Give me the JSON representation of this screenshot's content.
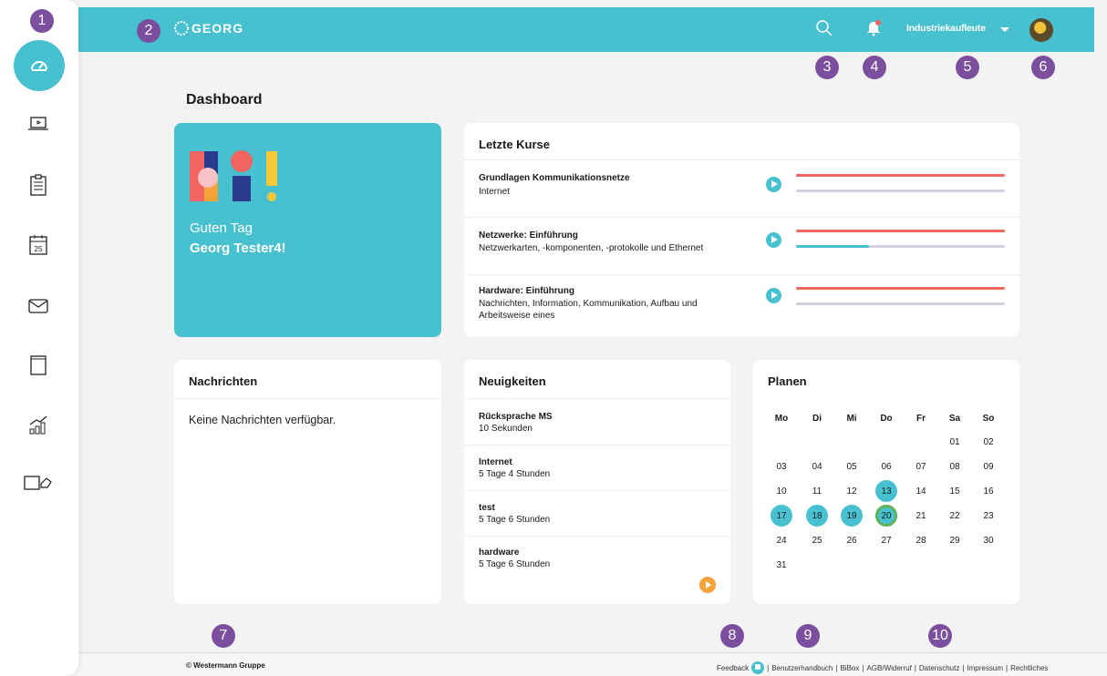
{
  "brand": {
    "name": "GEORG"
  },
  "header": {
    "role": "Industriekaufleute"
  },
  "page": {
    "title": "Dashboard"
  },
  "badges": [
    "1",
    "2",
    "3",
    "4",
    "5",
    "6",
    "7",
    "8",
    "9",
    "10"
  ],
  "sidebar": {
    "items": [
      "dashboard-gauge-icon",
      "course-laptop-icon",
      "clipboard-list-icon",
      "calendar-icon",
      "mail-icon",
      "book-icon",
      "statistics-icon",
      "media-tools-icon"
    ],
    "calendar_day": "25"
  },
  "hello": {
    "greeting": "Guten Tag",
    "name": "Georg Tester4!"
  },
  "courses": {
    "title": "Letzte Kurse",
    "items": [
      {
        "title": "Grundlagen Kommunikationsnetze",
        "subtitle": "Internet",
        "progress": 0
      },
      {
        "title": "Netzwerke: Einführung",
        "subtitle": "Netzwerkarten, -komponenten, -protokolle und Ethernet",
        "progress": 0.35
      },
      {
        "title": "Hardware: Einführung",
        "subtitle": "Nachrichten, Information, Kommunikation, Aufbau und Arbeitsweise eines",
        "progress": 0
      }
    ]
  },
  "messages": {
    "title": "Nachrichten",
    "empty": "Keine Nachrichten verfügbar."
  },
  "news": {
    "title": "Neuigkeiten",
    "items": [
      {
        "title": "Rücksprache MS",
        "time": "10 Sekunden"
      },
      {
        "title": "Internet",
        "time": "5 Tage 4 Stunden"
      },
      {
        "title": "test",
        "time": "5 Tage 6 Stunden"
      },
      {
        "title": "hardware",
        "time": "5 Tage 6 Stunden"
      }
    ]
  },
  "plan": {
    "title": "Planen",
    "weekdays": [
      "Mo",
      "Di",
      "Mi",
      "Do",
      "Fr",
      "Sa",
      "So"
    ],
    "rows": [
      [
        "",
        "",
        "",
        "",
        "",
        "01",
        "02"
      ],
      [
        "03",
        "04",
        "05",
        "06",
        "07",
        "08",
        "09"
      ],
      [
        "10",
        "11",
        "12",
        "13",
        "14",
        "15",
        "16"
      ],
      [
        "17",
        "18",
        "19",
        "20",
        "21",
        "22",
        "23"
      ],
      [
        "24",
        "25",
        "26",
        "27",
        "28",
        "29",
        "30"
      ],
      [
        "31",
        "",
        "",
        "",
        "",
        "",
        ""
      ]
    ],
    "marked": [
      "13",
      "17",
      "18",
      "19",
      "20"
    ],
    "today": "20"
  },
  "footer": {
    "copyright": "© Westermann Gruppe",
    "feedback": "Feedback",
    "links": [
      "Benutzerhandbuch",
      "BiBox",
      "AGB/Widerruf",
      "Datenschutz",
      "Impressum",
      "Rechtliches"
    ]
  }
}
